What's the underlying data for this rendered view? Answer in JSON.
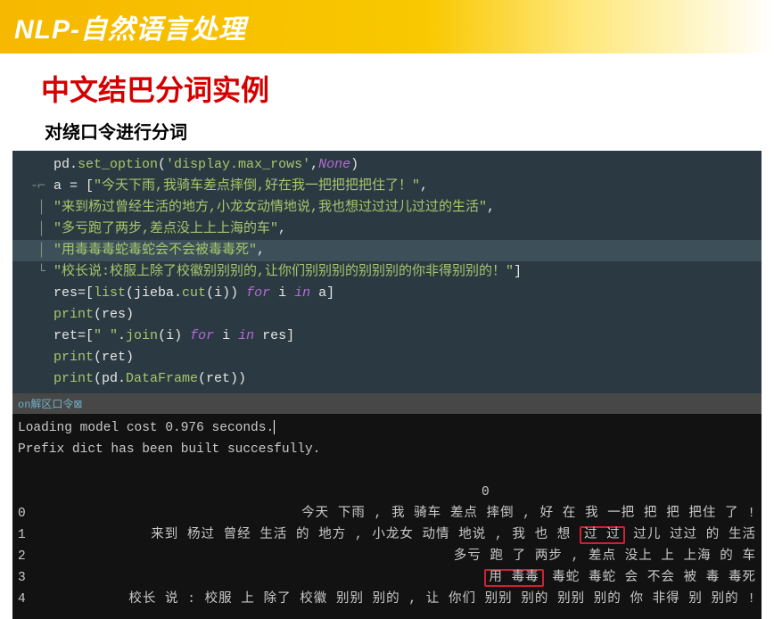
{
  "banner": {
    "title": "NLP-自然语言处理"
  },
  "section": {
    "title": "中文结巴分词实例",
    "subtitle": "对绕口令进行分词"
  },
  "code": {
    "l1a": "pd.",
    "l1b": "set_option",
    "l1c": "(",
    "l1d": "'display.max_rows'",
    "l1e": ",",
    "l1f": "None",
    "l1g": ")",
    "l2a": "a = [",
    "l2b": "\"今天下雨,我骑车差点摔倒,好在我一把把把把住了！\"",
    "l2c": ",",
    "l3a": "\"来到杨过曾经生活的地方,小龙女动情地说,我也想过过过儿过过的生活\"",
    "l3b": ",",
    "l4a": "\"多亏跑了两步,差点没上上上海的车\"",
    "l4b": ",",
    "l5a": "\"用毒毒毒蛇毒蛇会不会被毒毒死\"",
    "l5b": ",",
    "l6a": "\"校长说:校服上除了校徽别别别的,让你们别别别的别别别的你非得别别的！\"",
    "l6b": "]",
    "l7a": "res=[",
    "l7b": "list",
    "l7c": "(jieba.",
    "l7d": "cut",
    "l7e": "(i)) ",
    "l7f": "for",
    "l7g": " i ",
    "l7h": "in",
    "l7i": " a]",
    "l8a": "print",
    "l8b": "(res)",
    "l9a": "ret=[",
    "l9b": "\" \"",
    "l9c": ".",
    "l9d": "join",
    "l9e": "(i) ",
    "l9f": "for",
    "l9g": " i ",
    "l9h": "in",
    "l9i": " res]",
    "l10a": "print",
    "l10b": "(ret)",
    "l11a": "print",
    "l11b": "(pd.",
    "l11c": "DataFrame",
    "l11d": "(ret))"
  },
  "tab": {
    "label": "on解区口令",
    "close": "⊠"
  },
  "console": {
    "c1": "Loading model cost 0.976 seconds.",
    "c2": "Prefix dict has been built succesfully.",
    "hdr": "0",
    "r0i": "0",
    "r0t": "今天 下雨 , 我 骑车 差点 摔倒 , 好 在 我 一把 把 把 把住 了 !",
    "r1i": "1",
    "r1t_a": "来到 杨过 曾经 生活 的 地方 , 小龙女 动情 地说 , 我 也 想 ",
    "r1t_box": "过 过",
    "r1t_b": " 过儿 过过 的 生活",
    "r2i": "2",
    "r2t": "多亏 跑 了 两步 , 差点 没上 上 上海 的 车",
    "r3i": "3",
    "r3t_box": "用 毒毒",
    "r3t_b": " 毒蛇 毒蛇 会 不会 被 毒 毒死",
    "r4i": "4",
    "r4t": "校长 说 : 校服 上 除了 校徽 别别 别的 , 让 你们 别别 别的 别别 别的 你 非得 别 别的 !"
  }
}
